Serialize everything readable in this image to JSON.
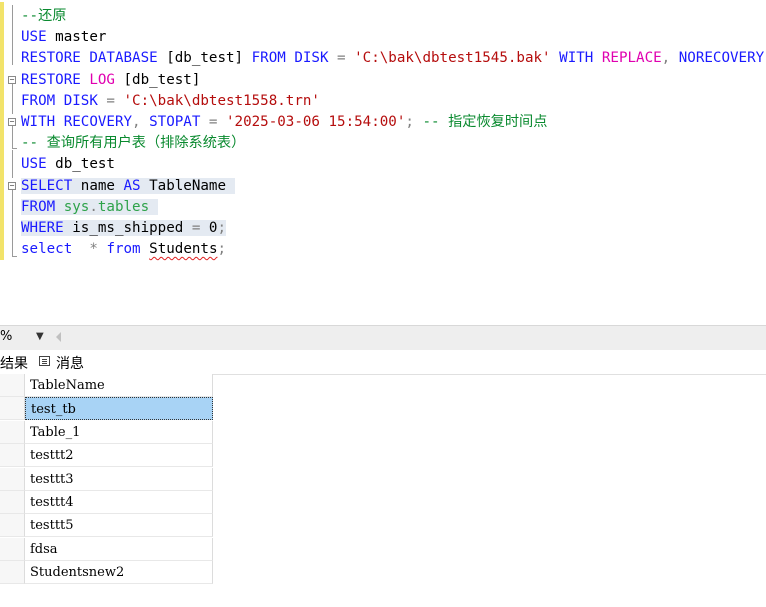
{
  "editor": {
    "lines": [
      [
        {
          "t": "--还原",
          "c": "cm"
        }
      ],
      [
        {
          "t": "USE",
          "c": "kw"
        },
        {
          "t": " master",
          "c": ""
        }
      ],
      [
        {
          "t": "RESTORE DATABASE",
          "c": "kw"
        },
        {
          "t": " [db_test] ",
          "c": ""
        },
        {
          "t": "FROM DISK",
          "c": "kw"
        },
        {
          "t": " = ",
          "c": "gray"
        },
        {
          "t": "'C:\\bak\\dbtest1545.bak'",
          "c": "str"
        },
        {
          "t": " WITH ",
          "c": "kw"
        },
        {
          "t": "REPLACE",
          "c": "fn"
        },
        {
          "t": ", ",
          "c": "gray"
        },
        {
          "t": "NORECOVERY",
          "c": "kw"
        },
        {
          "t": ";",
          "c": "gray"
        }
      ],
      [
        {
          "t": "RESTORE",
          "c": "kw"
        },
        {
          "t": " ",
          "c": ""
        },
        {
          "t": "LOG",
          "c": "fn"
        },
        {
          "t": " [db_test]",
          "c": ""
        }
      ],
      [
        {
          "t": "FROM DISK",
          "c": "kw"
        },
        {
          "t": " = ",
          "c": "gray"
        },
        {
          "t": "'C:\\bak\\dbtest1558.trn'",
          "c": "str"
        }
      ],
      [
        {
          "t": "WITH RECOVERY",
          "c": "kw"
        },
        {
          "t": ", ",
          "c": "gray"
        },
        {
          "t": "STOPAT",
          "c": "kw"
        },
        {
          "t": " = ",
          "c": "gray"
        },
        {
          "t": "'2025-03-06 15:54:00'",
          "c": "str"
        },
        {
          "t": "; ",
          "c": "gray"
        },
        {
          "t": "-- 指定恢复时间点",
          "c": "cm"
        }
      ],
      [
        {
          "t": "-- 查询所有用户表（排除系统表）",
          "c": "cm"
        }
      ],
      [
        {
          "t": "USE",
          "c": "kw"
        },
        {
          "t": " db_test",
          "c": ""
        }
      ],
      [
        {
          "t": "SELECT",
          "c": "kw"
        },
        {
          "t": " name ",
          "c": ""
        },
        {
          "t": "AS",
          "c": "kw"
        },
        {
          "t": " TableName ",
          "c": ""
        }
      ],
      [
        {
          "t": "FROM",
          "c": "kw"
        },
        {
          "t": " ",
          "c": ""
        },
        {
          "t": "sys",
          "c": "sys"
        },
        {
          "t": ".",
          "c": "gray"
        },
        {
          "t": "tables ",
          "c": "sys"
        }
      ],
      [
        {
          "t": "WHERE",
          "c": "kw"
        },
        {
          "t": " is_ms_shipped ",
          "c": ""
        },
        {
          "t": "=",
          "c": "gray"
        },
        {
          "t": " 0",
          "c": ""
        },
        {
          "t": ";",
          "c": "gray"
        }
      ],
      [
        {
          "t": "select",
          "c": "kw"
        },
        {
          "t": "  ",
          "c": ""
        },
        {
          "t": "*",
          "c": "gray"
        },
        {
          "t": " ",
          "c": ""
        },
        {
          "t": "from",
          "c": "kw"
        },
        {
          "t": " ",
          "c": ""
        },
        {
          "t": "Students",
          "c": "squiggle"
        },
        {
          "t": ";",
          "c": "gray"
        }
      ]
    ]
  },
  "zoom": {
    "value": "%"
  },
  "tabs": {
    "results": "结果",
    "messages": "消息"
  },
  "grid": {
    "header": "TableName",
    "rows": [
      "test_tb",
      "Table_1",
      "testtt2",
      "testtt3",
      "testtt4",
      "testtt5",
      "fdsa",
      "Studentsnew2"
    ],
    "selected_index": 0
  },
  "colors": {
    "keyword": "#1a1aff",
    "string": "#b50d0d",
    "comment": "#0a8a2f",
    "function": "#e000b0",
    "selection": "#a8d3f5"
  }
}
